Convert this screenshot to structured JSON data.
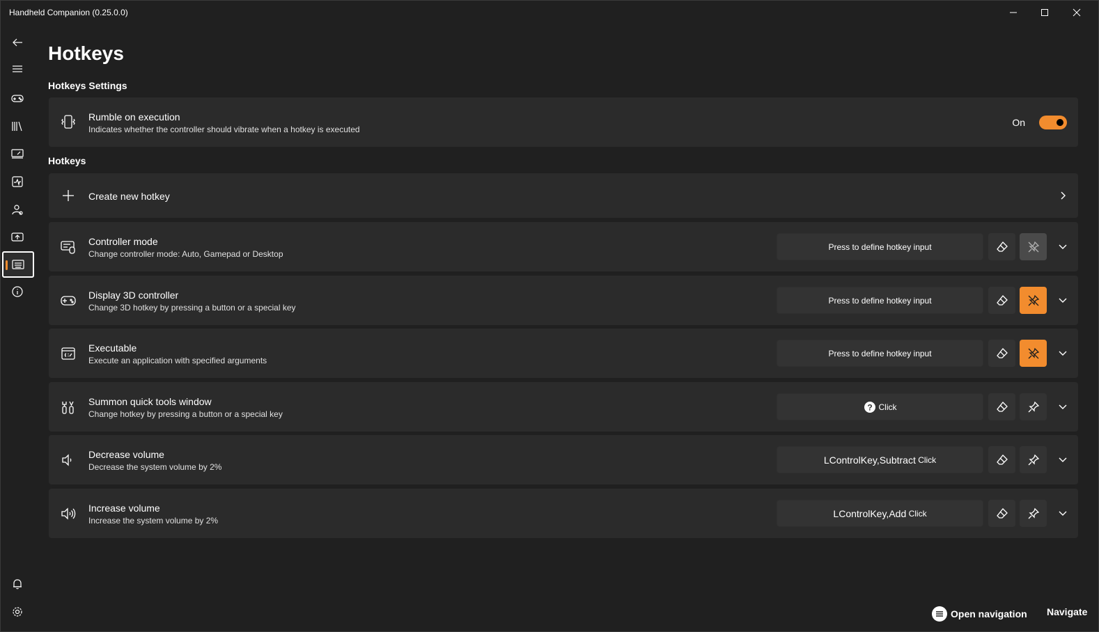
{
  "window": {
    "title": "Handheld Companion (0.25.0.0)"
  },
  "page": {
    "title": "Hotkeys"
  },
  "settings": {
    "section_title": "Hotkeys Settings",
    "rumble": {
      "title": "Rumble on execution",
      "description": "Indicates whether the controller should vibrate when a hotkey is executed",
      "toggle_label": "On",
      "enabled": true
    }
  },
  "hotkeys": {
    "section_title": "Hotkeys",
    "create_label": "Create new hotkey",
    "items": [
      {
        "title": "Controller mode",
        "description": "Change controller mode: Auto, Gamepad or Desktop",
        "input": "Press to define hotkey input",
        "pin_state": "disabled"
      },
      {
        "title": "Display 3D controller",
        "description": "Change 3D hotkey by pressing a button or a special key",
        "input": "Press to define hotkey input",
        "pin_state": "active"
      },
      {
        "title": "Executable",
        "description": "Execute an application with specified arguments",
        "input": "Press to define hotkey input",
        "pin_state": "active"
      },
      {
        "title": "Summon quick tools window",
        "description": "Change hotkey by pressing a button or a special key",
        "input": "Click",
        "pin_state": "normal"
      },
      {
        "title": "Decrease volume",
        "description": "Decrease the system volume by 2%",
        "input_keys": "LControlKey,Subtract",
        "input_suffix": "Click",
        "pin_state": "normal"
      },
      {
        "title": "Increase volume",
        "description": "Increase the system volume by 2%",
        "input_keys": "LControlKey,Add",
        "input_suffix": "Click",
        "pin_state": "normal"
      }
    ]
  },
  "footer": {
    "open_navigation": "Open navigation",
    "navigate": "Navigate"
  },
  "colors": {
    "accent": "#f28c2e",
    "background": "#202020",
    "card": "#2b2b2b"
  }
}
